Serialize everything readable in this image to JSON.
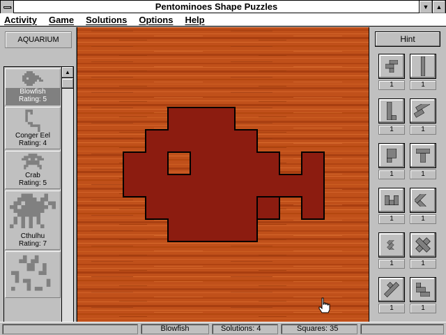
{
  "window": {
    "title": "Pentominoes Shape Puzzles"
  },
  "menu": {
    "items": [
      "Activity",
      "Game",
      "Solutions",
      "Options",
      "Help"
    ]
  },
  "left_panel": {
    "collection": "AQUARIUM",
    "puzzles": [
      {
        "name": "Blowfish",
        "rating": "Rating:  5",
        "icon": "blowfish-thumbnail",
        "selected": true
      },
      {
        "name": "Conger Eel",
        "rating": "Rating:  4",
        "icon": "conger-eel-thumbnail",
        "selected": false
      },
      {
        "name": "Crab",
        "rating": "Rating:  5",
        "icon": "crab-thumbnail",
        "selected": false
      },
      {
        "name": "Cthulhu",
        "rating": "Rating:  7",
        "icon": "cthulhu-thumbnail",
        "selected": false
      },
      {
        "name": "",
        "rating": "",
        "icon": "scatter-thumbnail",
        "selected": false
      }
    ]
  },
  "right_panel": {
    "hint_label": "Hint",
    "pieces": [
      {
        "name": "F",
        "count": "1"
      },
      {
        "name": "I",
        "count": "1"
      },
      {
        "name": "L",
        "count": "1"
      },
      {
        "name": "N",
        "count": "1"
      },
      {
        "name": "P",
        "count": "1"
      },
      {
        "name": "T",
        "count": "1"
      },
      {
        "name": "U",
        "count": "1"
      },
      {
        "name": "V",
        "count": "1"
      },
      {
        "name": "W",
        "count": "1"
      },
      {
        "name": "X",
        "count": "1"
      },
      {
        "name": "Y",
        "count": "1"
      },
      {
        "name": "Z",
        "count": "1"
      }
    ]
  },
  "board": {
    "puzzle": "Blowfish"
  },
  "status": {
    "puzzle": "Blowfish",
    "solutions": "Solutions:   4",
    "squares": "Squares: 35"
  },
  "colors": {
    "wood": "#c0501a",
    "target": "#8c1c10",
    "panel": "#c0c0c0"
  }
}
